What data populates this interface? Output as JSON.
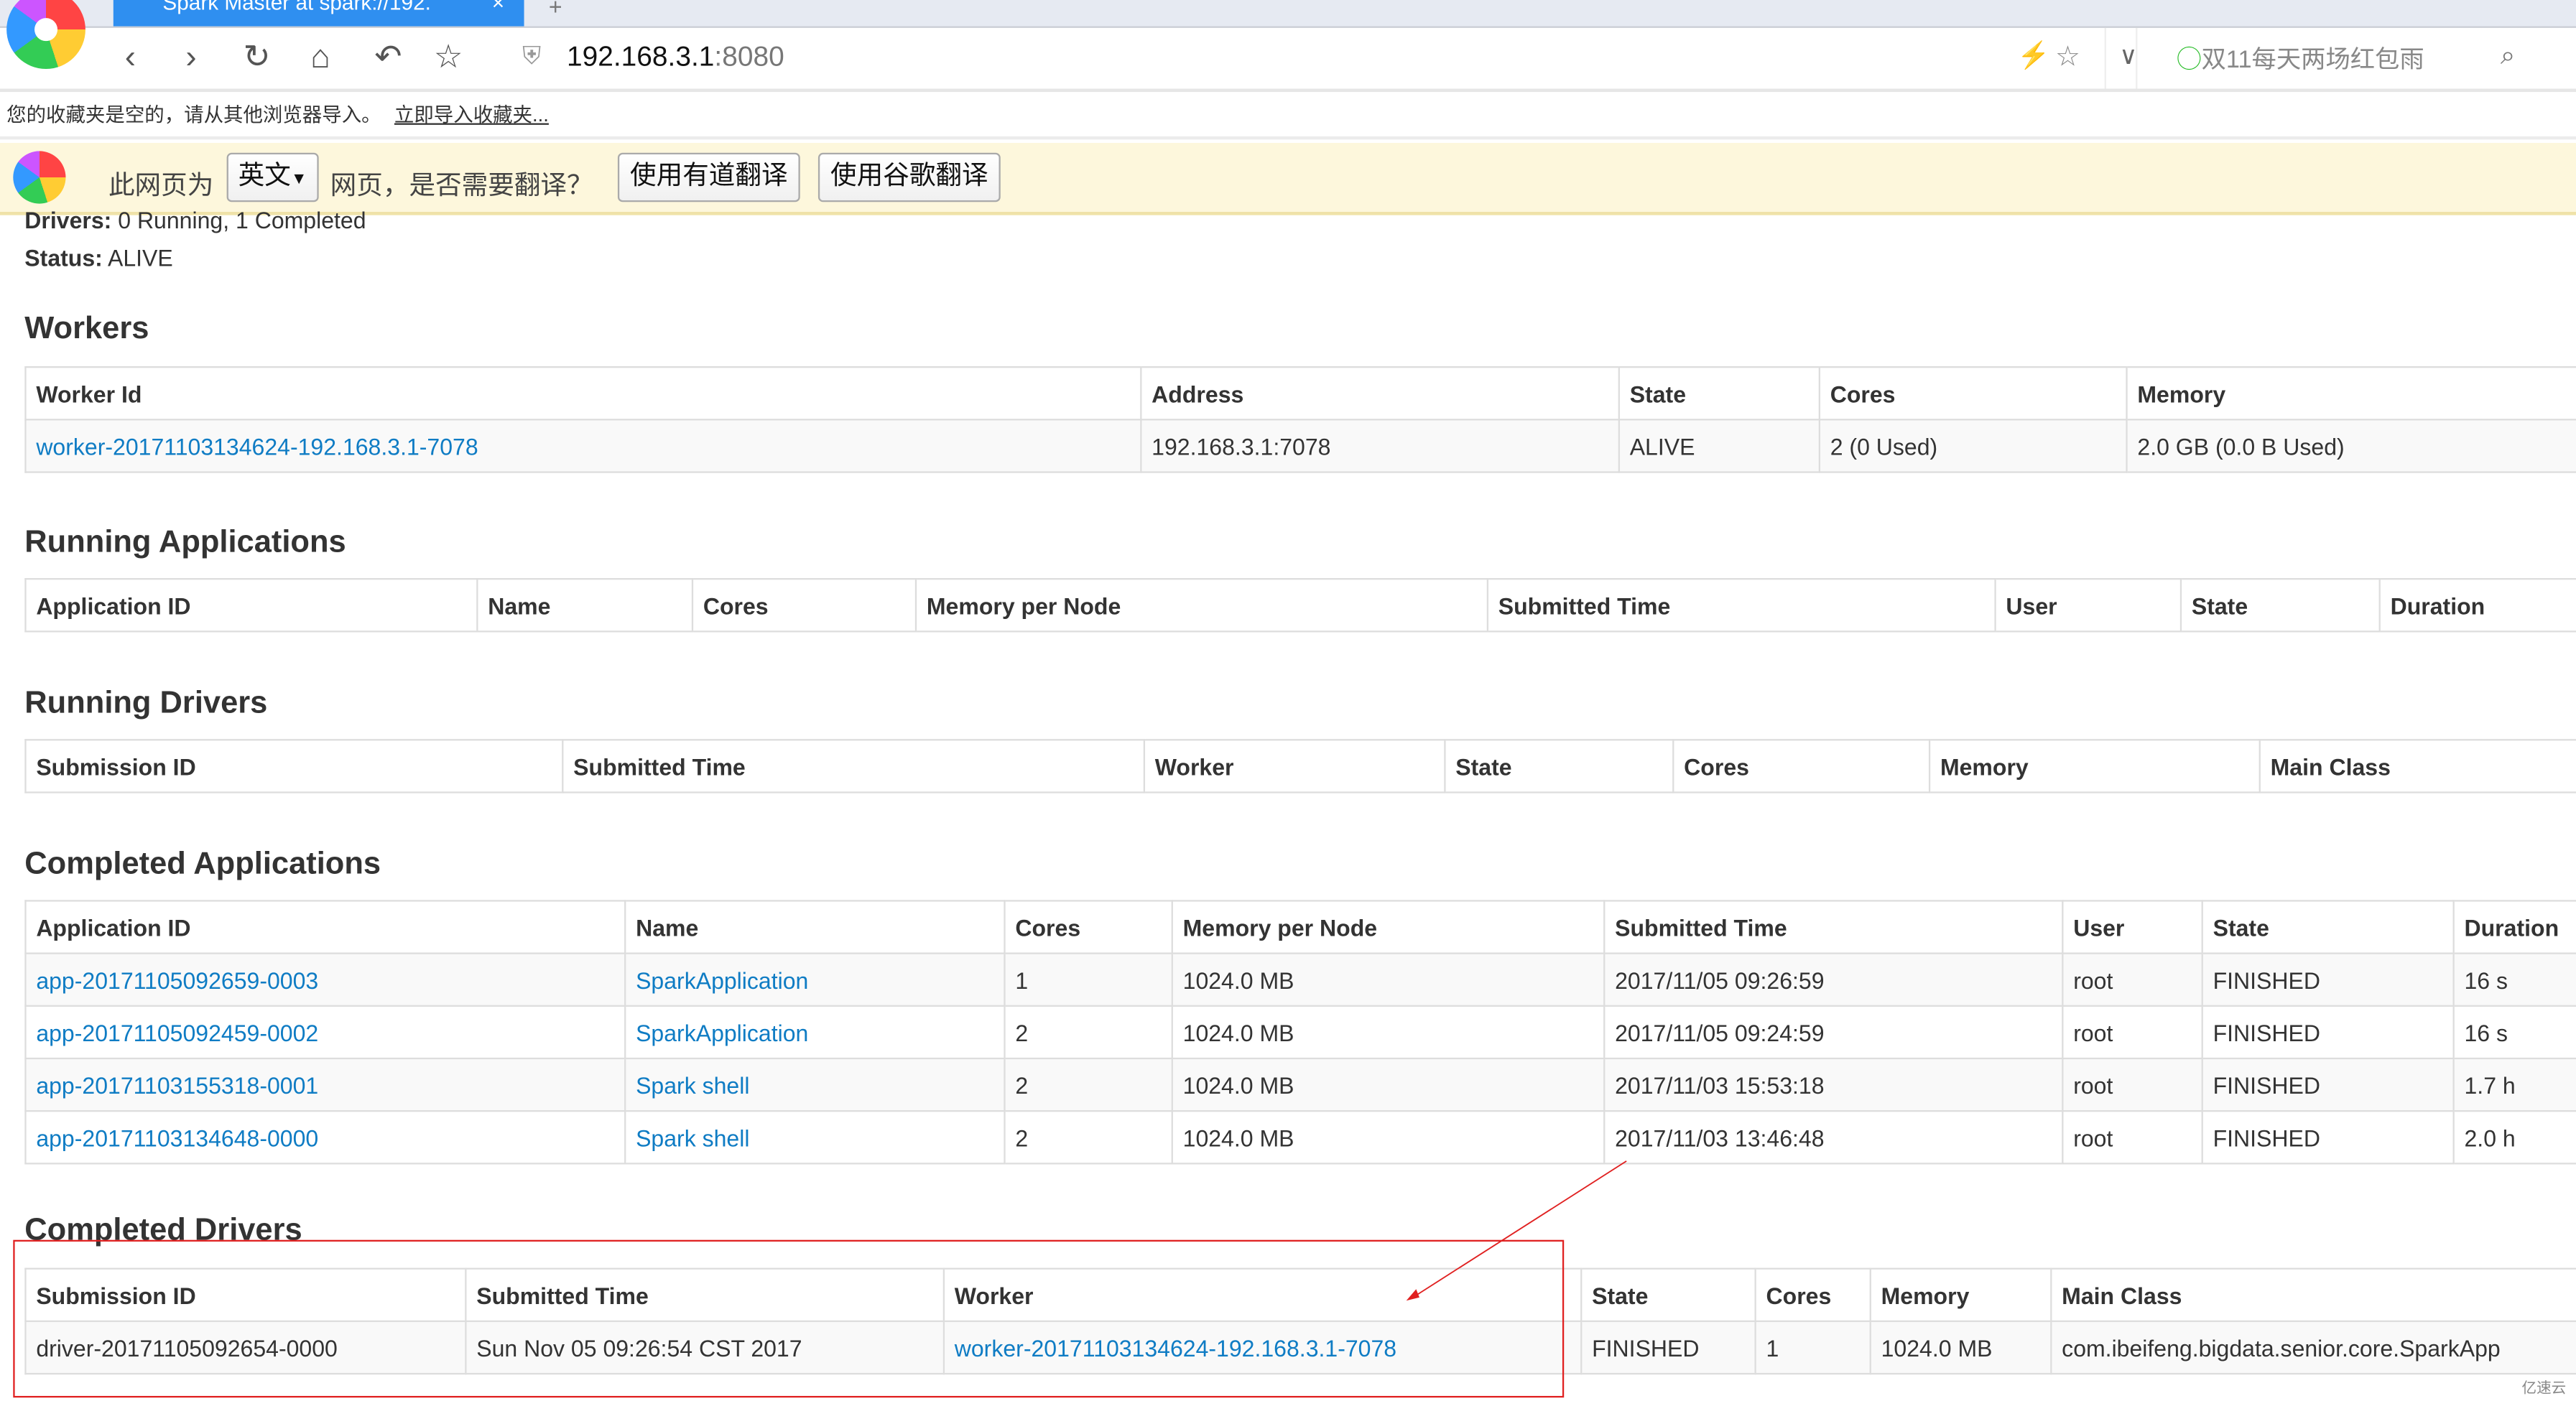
{
  "browser": {
    "tab_title": "Spark Master at spark://192.",
    "tab_close": "×",
    "new_tab": "+",
    "url_host": "192.168.3.1",
    "url_port": ":8080",
    "search_hint": "双11每天两场红包雨",
    "bookmarks_empty": "您的收藏夹是空的，请从其他浏览器导入。",
    "bookmarks_import": "立即导入收藏夹...",
    "translate": {
      "prefix": "此网页为",
      "language": "英文",
      "question": "网页，是否需要翻译？",
      "youdao": "使用有道翻译",
      "google": "使用谷歌翻译"
    }
  },
  "summary": {
    "drivers_label": "Drivers:",
    "drivers_value": "0 Running, 1 Completed",
    "status_label": "Status:",
    "status_value": "ALIVE"
  },
  "sections": {
    "workers": {
      "title": "Workers",
      "headers": [
        "Worker Id",
        "Address",
        "State",
        "Cores",
        "Memory"
      ],
      "link_cols": [
        0
      ],
      "rows": [
        [
          "worker-20171103134624-192.168.3.1-7078",
          "192.168.3.1:7078",
          "ALIVE",
          "2 (0 Used)",
          "2.0 GB (0.0 B Used)"
        ]
      ]
    },
    "running_apps": {
      "title": "Running Applications",
      "headers": [
        "Application ID",
        "Name",
        "Cores",
        "Memory per Node",
        "Submitted Time",
        "User",
        "State",
        "Duration"
      ],
      "link_cols": [],
      "rows": []
    },
    "running_drivers": {
      "title": "Running Drivers",
      "headers": [
        "Submission ID",
        "Submitted Time",
        "Worker",
        "State",
        "Cores",
        "Memory",
        "Main Class"
      ],
      "link_cols": [],
      "rows": []
    },
    "completed_apps": {
      "title": "Completed Applications",
      "headers": [
        "Application ID",
        "Name",
        "Cores",
        "Memory per Node",
        "Submitted Time",
        "User",
        "State",
        "Duration"
      ],
      "link_cols": [
        0,
        1
      ],
      "rows": [
        [
          "app-20171105092659-0003",
          "SparkApplication",
          "1",
          "1024.0 MB",
          "2017/11/05 09:26:59",
          "root",
          "FINISHED",
          "16 s"
        ],
        [
          "app-20171105092459-0002",
          "SparkApplication",
          "2",
          "1024.0 MB",
          "2017/11/05 09:24:59",
          "root",
          "FINISHED",
          "16 s"
        ],
        [
          "app-20171103155318-0001",
          "Spark shell",
          "2",
          "1024.0 MB",
          "2017/11/03 15:53:18",
          "root",
          "FINISHED",
          "1.7 h"
        ],
        [
          "app-20171103134648-0000",
          "Spark shell",
          "2",
          "1024.0 MB",
          "2017/11/03 13:46:48",
          "root",
          "FINISHED",
          "2.0 h"
        ]
      ]
    },
    "completed_drivers": {
      "title": "Completed Drivers",
      "headers": [
        "Submission ID",
        "Submitted Time",
        "Worker",
        "State",
        "Cores",
        "Memory",
        "Main Class"
      ],
      "link_cols": [
        2
      ],
      "rows": [
        [
          "driver-20171105092654-0000",
          "Sun Nov 05 09:26:54 CST 2017",
          "worker-20171103134624-192.168.3.1-7078",
          "FINISHED",
          "1",
          "1024.0 MB",
          "com.ibeifeng.bigdata.senior.core.SparkApp"
        ]
      ]
    }
  },
  "annotation": {
    "color": "#e02020"
  },
  "watermark": "亿速云",
  "colors": {
    "link": "#0f7cc4",
    "tab_active": "#2f8ff0",
    "translate_bar": "#fdf7dc"
  }
}
